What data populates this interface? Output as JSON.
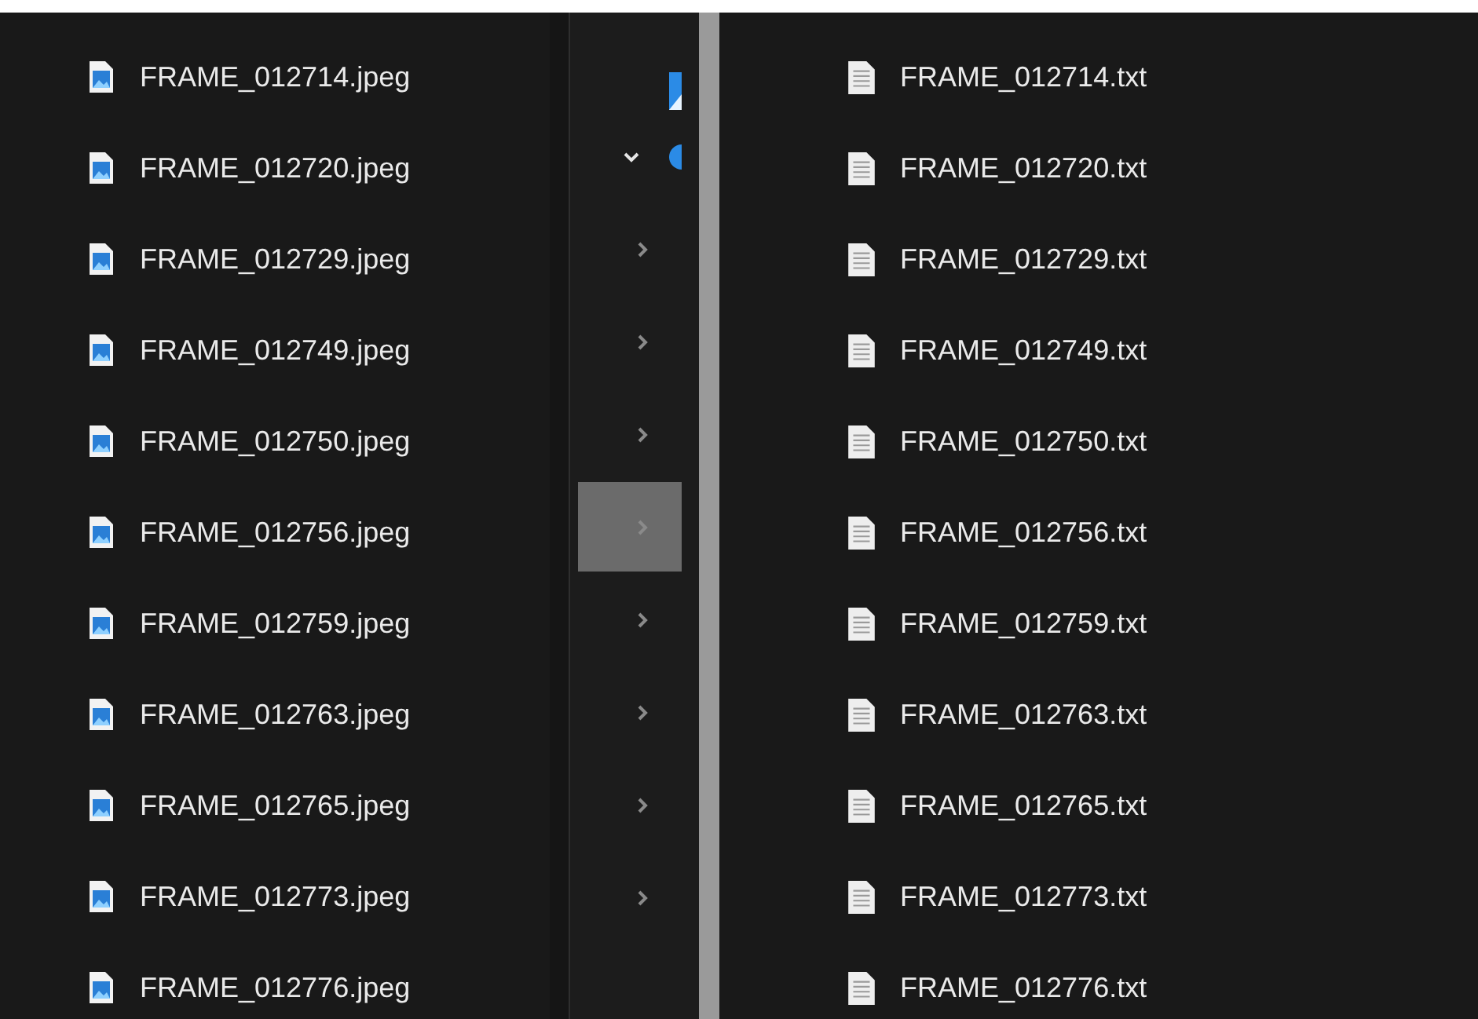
{
  "left_files": [
    {
      "name": "FRAME_012714.jpeg"
    },
    {
      "name": "FRAME_012720.jpeg"
    },
    {
      "name": "FRAME_012729.jpeg"
    },
    {
      "name": "FRAME_012749.jpeg"
    },
    {
      "name": "FRAME_012750.jpeg"
    },
    {
      "name": "FRAME_012756.jpeg"
    },
    {
      "name": "FRAME_012759.jpeg"
    },
    {
      "name": "FRAME_012763.jpeg"
    },
    {
      "name": "FRAME_012765.jpeg"
    },
    {
      "name": "FRAME_012773.jpeg"
    },
    {
      "name": "FRAME_012776.jpeg"
    }
  ],
  "nav_tree": [
    {
      "kind": "leaf"
    },
    {
      "kind": "branch",
      "expanded": true,
      "selected": false
    },
    {
      "kind": "branch",
      "expanded": false,
      "selected": false
    },
    {
      "kind": "branch",
      "expanded": false,
      "selected": false
    },
    {
      "kind": "branch",
      "expanded": false,
      "selected": false
    },
    {
      "kind": "branch",
      "expanded": false,
      "selected": true
    },
    {
      "kind": "branch",
      "expanded": false,
      "selected": false
    },
    {
      "kind": "branch",
      "expanded": false,
      "selected": false
    },
    {
      "kind": "branch",
      "expanded": false,
      "selected": false
    },
    {
      "kind": "branch",
      "expanded": false,
      "selected": false
    }
  ],
  "right_files": [
    {
      "name": "FRAME_012714.txt"
    },
    {
      "name": "FRAME_012720.txt"
    },
    {
      "name": "FRAME_012729.txt"
    },
    {
      "name": "FRAME_012749.txt"
    },
    {
      "name": "FRAME_012750.txt"
    },
    {
      "name": "FRAME_012756.txt"
    },
    {
      "name": "FRAME_012759.txt"
    },
    {
      "name": "FRAME_012763.txt"
    },
    {
      "name": "FRAME_012765.txt"
    },
    {
      "name": "FRAME_012773.txt"
    },
    {
      "name": "FRAME_012776.txt"
    }
  ]
}
